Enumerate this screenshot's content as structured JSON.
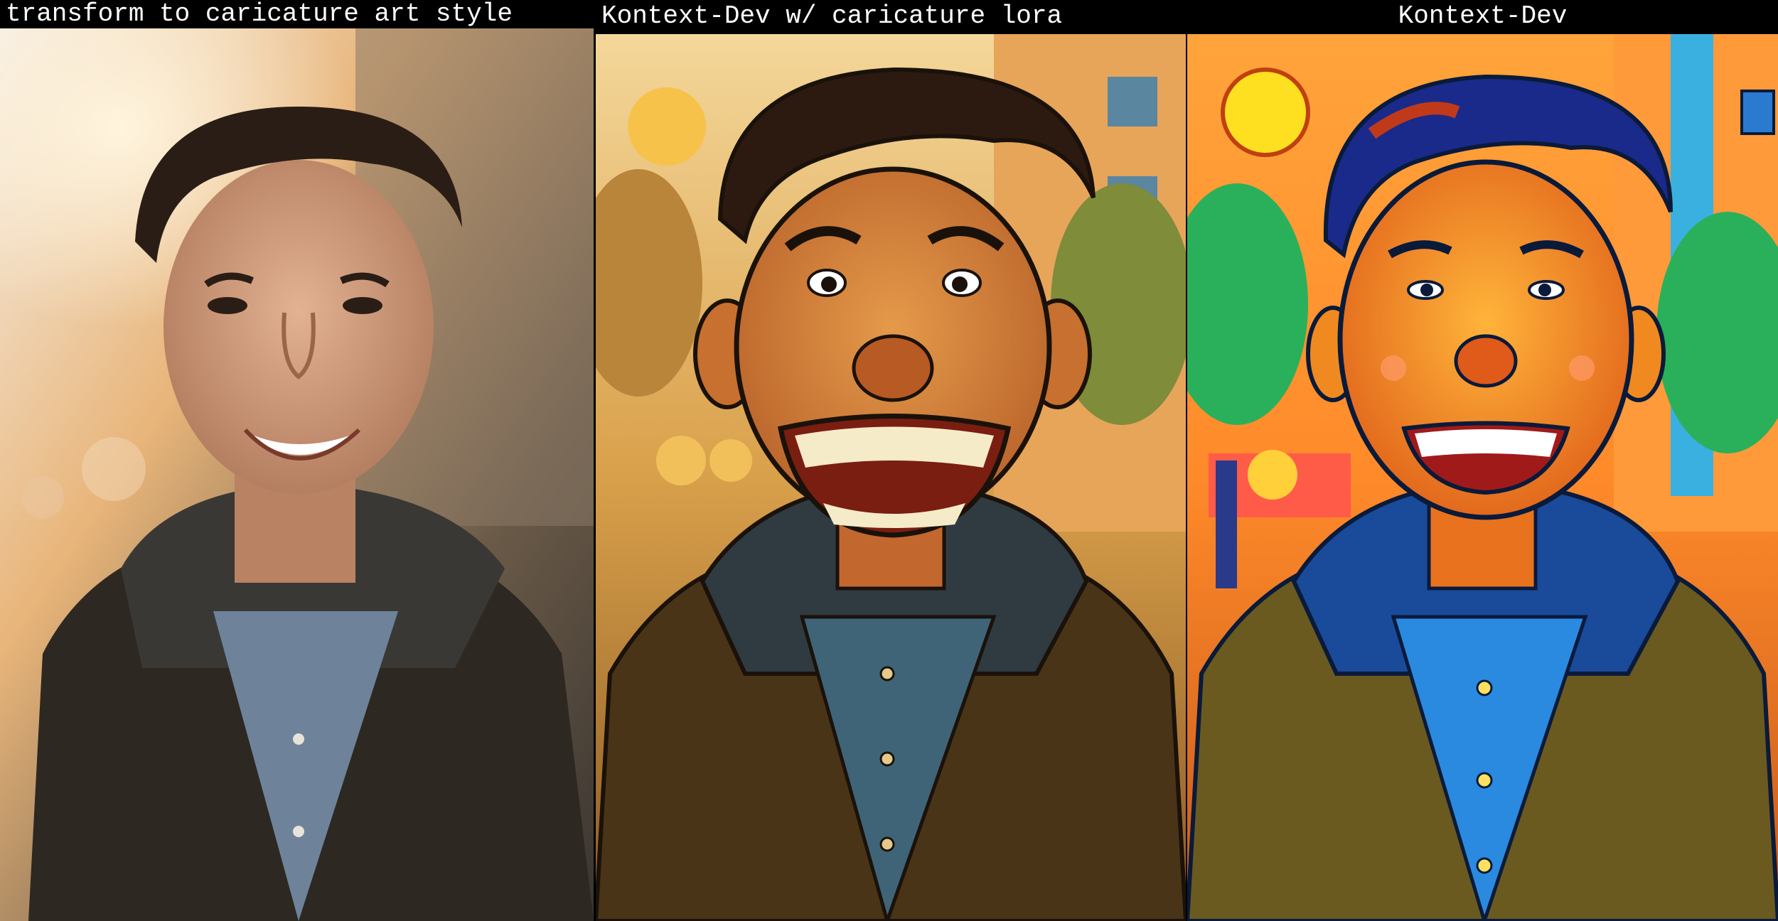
{
  "panels": [
    {
      "label": "transform to caricature art style"
    },
    {
      "label": "Kontext-Dev w/ caricature lora"
    },
    {
      "label": "Kontext-Dev"
    }
  ]
}
